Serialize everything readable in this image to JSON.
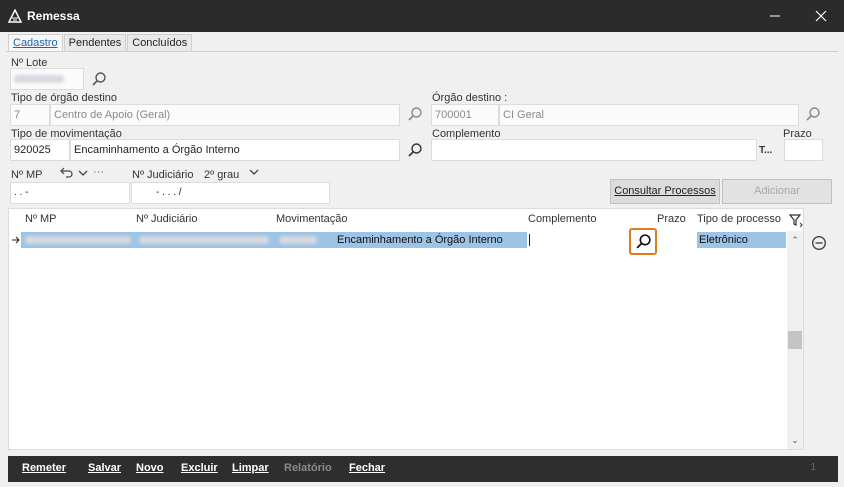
{
  "window": {
    "title": "Remessa",
    "minimize_icon": "minimize-icon",
    "close_icon": "close-icon"
  },
  "tabs": [
    {
      "label": "Cadastro",
      "active": true
    },
    {
      "label": "Pendentes",
      "active": false
    },
    {
      "label": "Concluídos",
      "active": false
    }
  ],
  "form": {
    "lote_label": "Nº Lote",
    "tipo_orgao_label": "Tipo de órgão destino",
    "tipo_orgao_code": "7",
    "tipo_orgao_name": "Centro de Apoio (Geral)",
    "orgao_label": "Órgão destino :",
    "orgao_code": "700001",
    "orgao_name": "CI Geral",
    "tipo_mov_label": "Tipo de movimentação",
    "tipo_mov_code": "920025",
    "tipo_mov_name": "Encaminhamento a Órgão Interno",
    "complemento_label": "Complemento",
    "complemento_value": "",
    "complemento_more": "T...",
    "prazo_label": "Prazo",
    "prazo_value": "",
    "nmp_label": "Nº MP",
    "nmp_mask": ".     .        -",
    "njud_label": "Nº Judiciário",
    "grau_label": "2º grau",
    "njud_mask": "-   .  .   .  /",
    "more_label": "···"
  },
  "buttons": {
    "consultar": "Consultar Processos",
    "adicionar": "Adicionar"
  },
  "grid": {
    "columns": [
      "Nº MP",
      "Nº Judiciário",
      "Movimentação",
      "Complemento",
      "Prazo",
      "Tipo de processo"
    ],
    "rows": [
      {
        "movimentacao": "Encaminhamento a Órgão Interno",
        "complemento": "",
        "prazo": "",
        "tipo_processo": "Eletrônico"
      }
    ]
  },
  "footer": {
    "remeter": "Remeter",
    "salvar": "Salvar",
    "novo": "Novo",
    "excluir": "Excluir",
    "limpar": "Limpar",
    "relatorio": "Relatório",
    "fechar": "Fechar",
    "count": "1"
  },
  "colors": {
    "accent_selection": "#9dc3e6",
    "highlight_border": "#e07a1f",
    "titlebar": "#2b2b2b",
    "tab_active_text": "#1d62b7"
  }
}
